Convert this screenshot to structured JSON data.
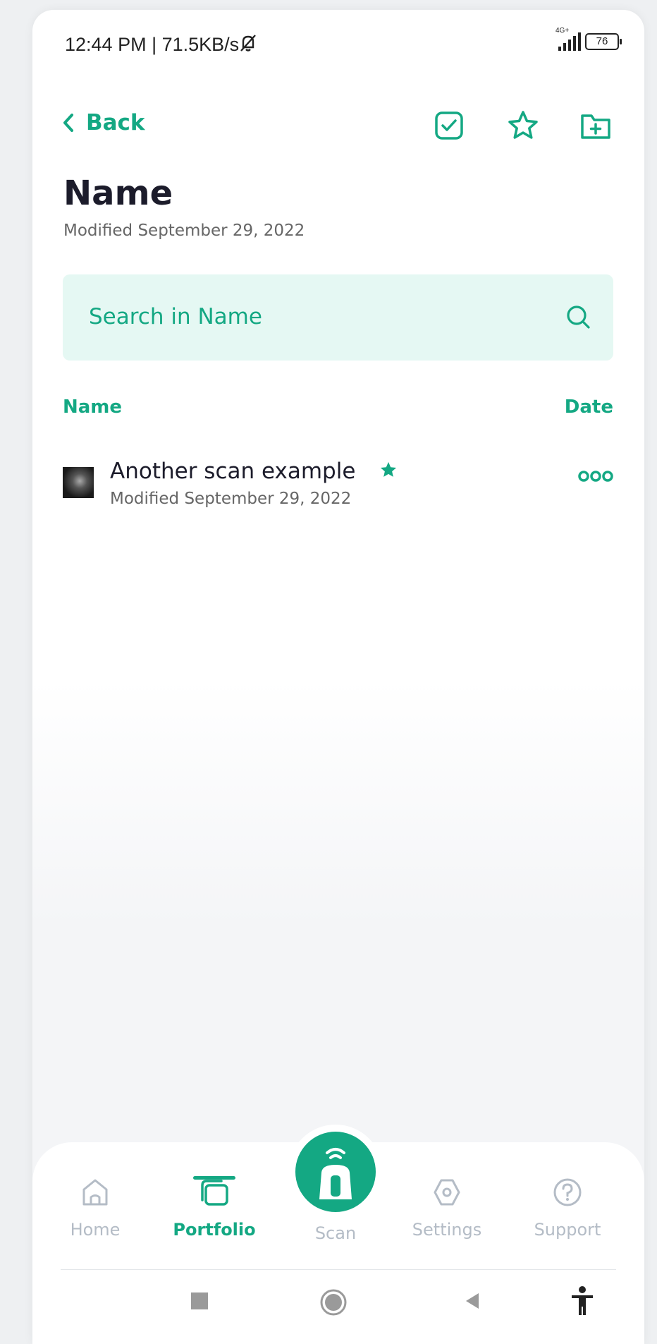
{
  "status_bar": {
    "time": "12:44 PM | 71.5KB/s",
    "network": "4G+",
    "battery": "76"
  },
  "header": {
    "back_label": "Back",
    "icons": [
      "check-square-icon",
      "star-outline-icon",
      "folder-plus-icon"
    ]
  },
  "folder": {
    "title": "Name",
    "modified": "Modified September 29, 2022"
  },
  "search": {
    "placeholder": "Search in Name"
  },
  "columns": {
    "name": "Name",
    "date": "Date"
  },
  "files": [
    {
      "name": "Another scan example",
      "modified": "Modified September 29, 2022",
      "favorite": true
    }
  ],
  "bottom_nav": {
    "items": [
      {
        "label": "Home",
        "icon": "home-icon",
        "active": false
      },
      {
        "label": "Portfolio",
        "icon": "portfolio-icon",
        "active": true
      },
      {
        "label": "Scan",
        "icon": "scanner-icon",
        "active": false
      },
      {
        "label": "Settings",
        "icon": "settings-icon",
        "active": false
      },
      {
        "label": "Support",
        "icon": "help-icon",
        "active": false
      }
    ]
  },
  "colors": {
    "accent": "#14a883",
    "search_bg": "#e5f8f3",
    "inactive": "#b4bcc6",
    "text": "#1c1c2b"
  }
}
